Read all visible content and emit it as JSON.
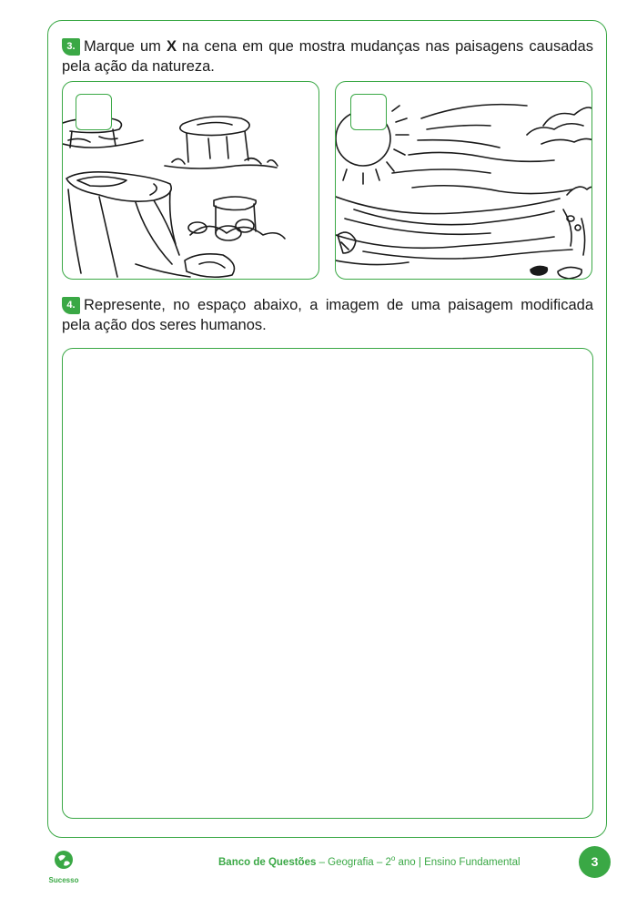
{
  "question3": {
    "number": "3.",
    "text_before": "Marque um",
    "mark": "X",
    "text_after": "na cena em que mostra mudanças nas paisagens causadas pela ação da natureza."
  },
  "question4": {
    "number": "4.",
    "text": "Represente, no espaço abaixo, a imagem de uma paisagem modificada pela ação dos seres humanos."
  },
  "footer": {
    "logo_text": "Sucesso",
    "collection": "Banco de Questões",
    "separator": " – Geografia – 2",
    "ordinal": "o",
    "grade": " ano | Ensino Fundamental",
    "page_number": "3"
  },
  "scenes": [
    {
      "icon": "tree-stumps-icon"
    },
    {
      "icon": "storm-sun-icon"
    }
  ],
  "colors": {
    "accent": "#3aa845",
    "text": "#1a1a1a"
  }
}
